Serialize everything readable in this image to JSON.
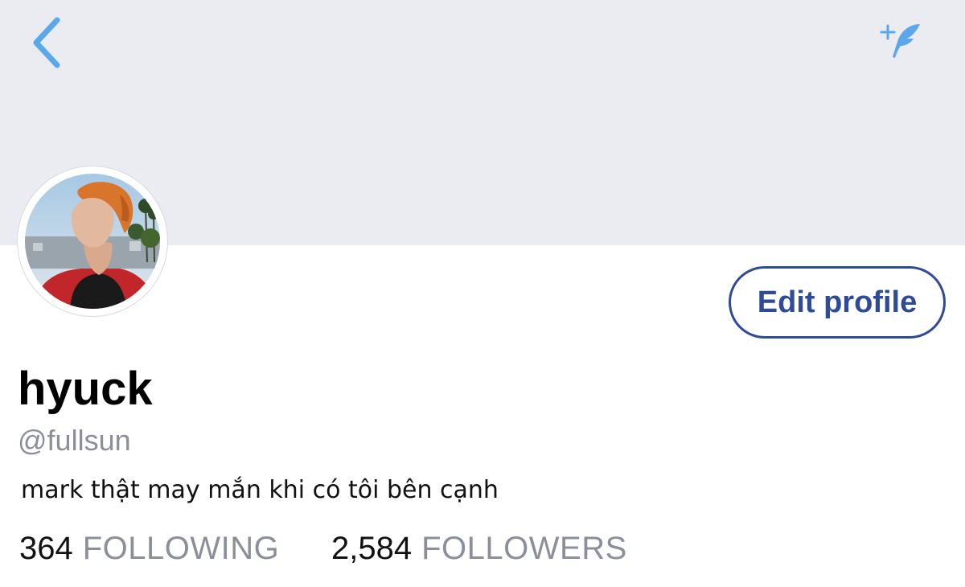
{
  "colors": {
    "banner": "#ebebf2",
    "accent": "#5aa7ea",
    "button_border": "#2f4b98",
    "secondary_text": "#8a8f99"
  },
  "header": {
    "back_icon": "chevron-left-icon",
    "compose_icon": "compose-tweet-icon"
  },
  "profile": {
    "avatar": "profile-photo",
    "edit_button_label": "Edit profile",
    "display_name": "hyuck",
    "handle": "@fullsun",
    "bio": "mark thật may mắn khi có tôi bên cạnh"
  },
  "stats": {
    "following_count": "364",
    "following_label": "FOLLOWING",
    "followers_count": "2,584",
    "followers_label": "FOLLOWERS"
  }
}
